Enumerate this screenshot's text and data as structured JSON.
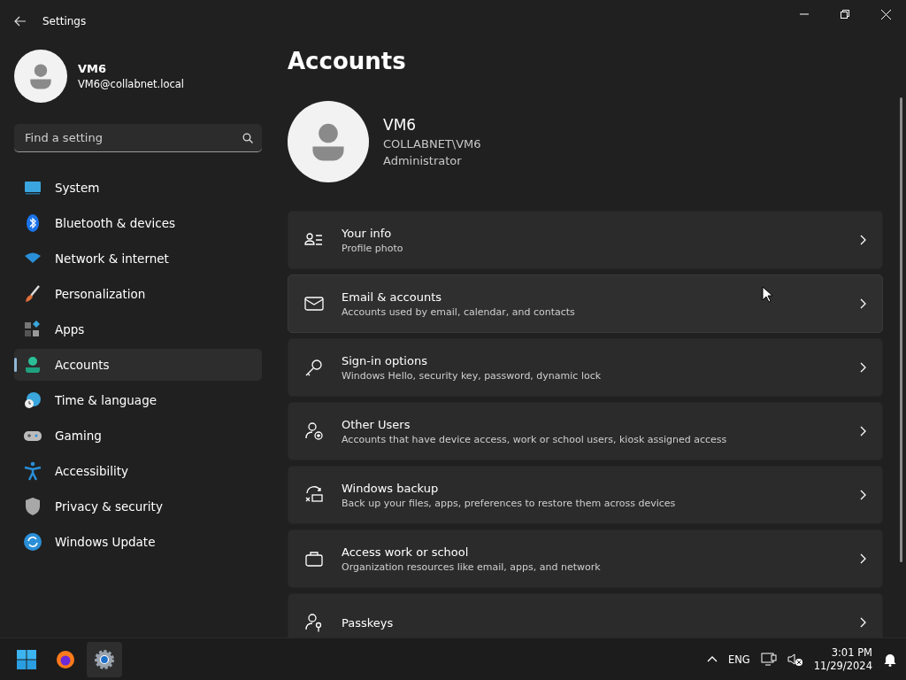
{
  "window": {
    "title": "Settings"
  },
  "user": {
    "name": "VM6",
    "email": "VM6@collabnet.local"
  },
  "search": {
    "placeholder": "Find a setting"
  },
  "sidebar": {
    "items": [
      {
        "label": "System",
        "selected": false
      },
      {
        "label": "Bluetooth & devices",
        "selected": false
      },
      {
        "label": "Network & internet",
        "selected": false
      },
      {
        "label": "Personalization",
        "selected": false
      },
      {
        "label": "Apps",
        "selected": false
      },
      {
        "label": "Accounts",
        "selected": true
      },
      {
        "label": "Time & language",
        "selected": false
      },
      {
        "label": "Gaming",
        "selected": false
      },
      {
        "label": "Accessibility",
        "selected": false
      },
      {
        "label": "Privacy & security",
        "selected": false
      },
      {
        "label": "Windows Update",
        "selected": false
      }
    ]
  },
  "page": {
    "title": "Accounts"
  },
  "account": {
    "name": "VM6",
    "domain": "COLLABNET\\VM6",
    "role": "Administrator"
  },
  "cards": [
    {
      "title": "Your info",
      "subtitle": "Profile photo",
      "hovered": false
    },
    {
      "title": "Email & accounts",
      "subtitle": "Accounts used by email, calendar, and contacts",
      "hovered": true
    },
    {
      "title": "Sign-in options",
      "subtitle": "Windows Hello, security key, password, dynamic lock",
      "hovered": false
    },
    {
      "title": "Other Users",
      "subtitle": "Accounts that have device access, work or school users, kiosk assigned access",
      "hovered": false
    },
    {
      "title": "Windows backup",
      "subtitle": "Back up your files, apps, preferences to restore them across devices",
      "hovered": false
    },
    {
      "title": "Access work or school",
      "subtitle": "Organization resources like email, apps, and network",
      "hovered": false
    },
    {
      "title": "Passkeys",
      "hovered": false
    }
  ],
  "taskbar": {
    "language": "ENG",
    "time": "3:01 PM",
    "date": "11/29/2024"
  }
}
